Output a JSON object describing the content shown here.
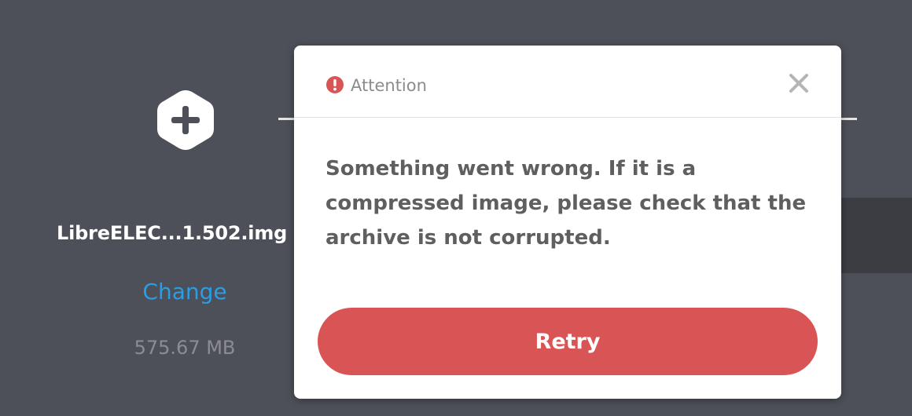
{
  "colors": {
    "background": "#4d5058",
    "accent_link": "#2a9de4",
    "danger": "#d95555",
    "modal_bg": "#ffffff"
  },
  "image_panel": {
    "icon": "plus-hexagon-icon",
    "file_name": "LibreELEC...1.502.img",
    "change_label": "Change",
    "file_size": "575.67 MB"
  },
  "modal": {
    "icon": "exclamation-circle-icon",
    "title": "Attention",
    "close_icon": "close-icon",
    "message": "Something went wrong. If it is a compressed image, please check that the archive is not corrupted.",
    "retry_label": "Retry"
  }
}
